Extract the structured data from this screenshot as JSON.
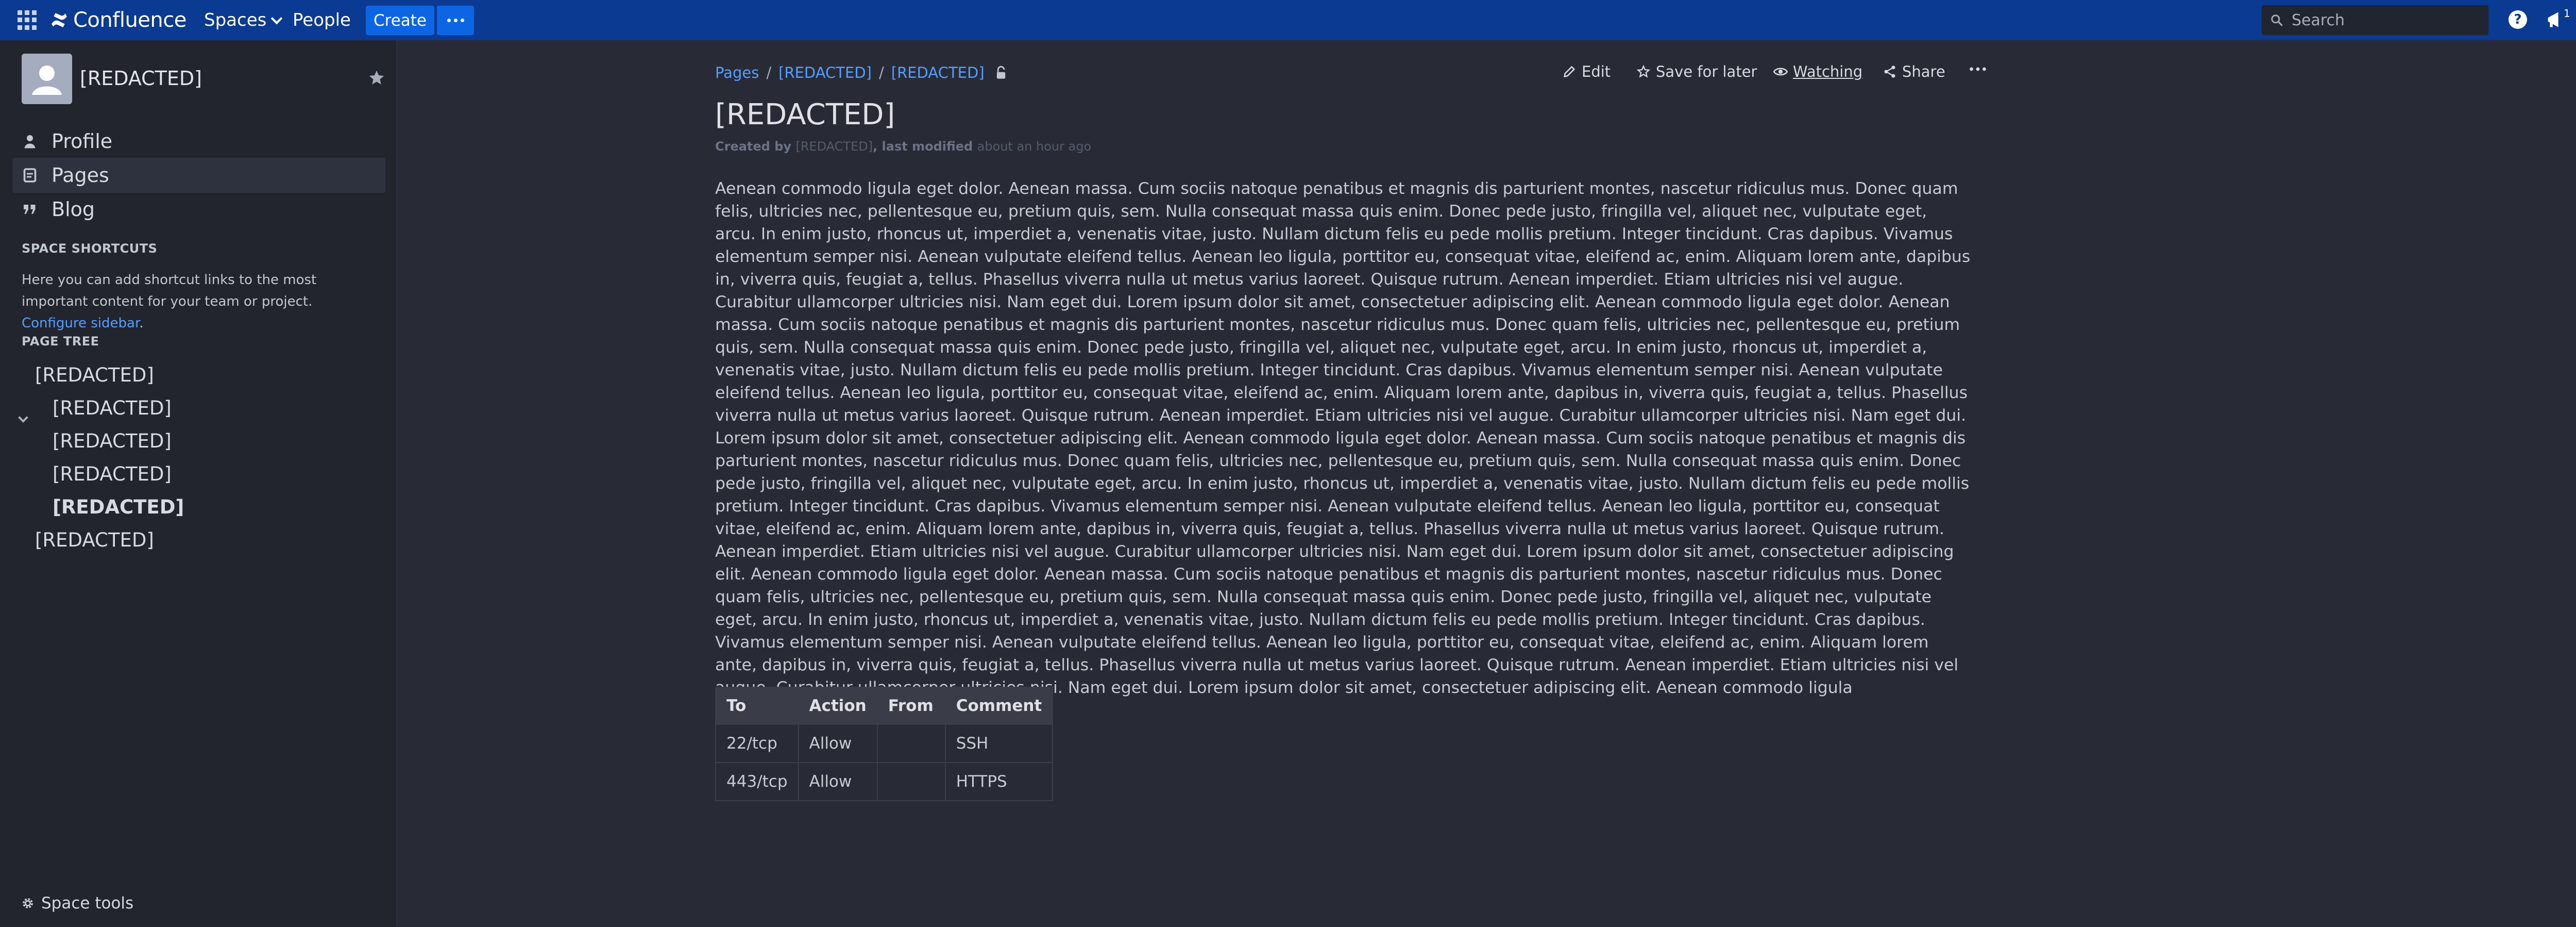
{
  "topnav": {
    "logo_text": "Confluence",
    "spaces_label": "Spaces",
    "people_label": "People",
    "create_label": "Create",
    "search_placeholder": "Search",
    "help_label": "?",
    "notification_count": "1"
  },
  "sidebar": {
    "space_name": "[REDACTED]",
    "items": [
      {
        "label": "Profile",
        "icon": "person-icon"
      },
      {
        "label": "Pages",
        "icon": "document-icon"
      },
      {
        "label": "Blog",
        "icon": "quote-icon"
      }
    ],
    "shortcuts_heading": "SPACE SHORTCUTS",
    "shortcuts_text": "Here you can add shortcut links to the most important content for your team or project.",
    "shortcuts_link": "Configure sidebar",
    "shortcuts_after": ".",
    "page_tree_heading": "PAGE TREE",
    "tree": [
      {
        "label": "[REDACTED]",
        "level": 0
      },
      {
        "label": "[REDACTED]",
        "level": 1
      },
      {
        "label": "[REDACTED]",
        "level": 1
      },
      {
        "label": "[REDACTED]",
        "level": 1
      },
      {
        "label": "[REDACTED]",
        "level": 1,
        "current": true
      },
      {
        "label": "[REDACTED]",
        "level": 0
      }
    ],
    "space_tools_label": "Space tools"
  },
  "breadcrumb": [
    "Pages",
    "[REDACTED]",
    "[REDACTED]"
  ],
  "breadcrumb_sep": "/",
  "actions": {
    "edit": "Edit",
    "save_for_later": "Save for later",
    "watching": "Watching",
    "share": "Share"
  },
  "page": {
    "title": "[REDACTED]",
    "byline_created": "Created by",
    "byline_author": "[REDACTED]",
    "byline_modified": ", last modified",
    "byline_time": "about an hour ago",
    "body": "Aenean commodo ligula eget dolor. Aenean massa. Cum sociis natoque penatibus et magnis dis parturient montes, nascetur ridiculus mus. Donec quam felis, ultricies nec, pellentesque eu, pretium quis, sem. Nulla consequat massa quis enim. Donec pede justo, fringilla vel, aliquet nec, vulputate eget, arcu. In enim justo, rhoncus ut, imperdiet a, venenatis vitae, justo. Nullam dictum felis eu pede mollis pretium. Integer tincidunt. Cras dapibus. Vivamus elementum semper nisi. Aenean vulputate eleifend tellus. Aenean leo ligula, porttitor eu, consequat vitae, eleifend ac, enim. Aliquam lorem ante, dapibus in, viverra quis, feugiat a, tellus. Phasellus viverra nulla ut metus varius laoreet. Quisque rutrum. Aenean imperdiet. Etiam ultricies nisi vel augue. Curabitur ullamcorper ultricies nisi. Nam eget dui. Lorem ipsum dolor sit amet, consectetuer adipiscing elit. Aenean commodo ligula eget dolor. Aenean massa. Cum sociis natoque penatibus et magnis dis parturient montes, nascetur ridiculus mus. Donec quam felis, ultricies nec, pellentesque eu, pretium quis, sem. Nulla consequat massa quis enim. Donec pede justo, fringilla vel, aliquet nec, vulputate eget, arcu. In enim justo, rhoncus ut, imperdiet a, venenatis vitae, justo. Nullam dictum felis eu pede mollis pretium. Integer tincidunt. Cras dapibus. Vivamus elementum semper nisi. Aenean vulputate eleifend tellus. Aenean leo ligula, porttitor eu, consequat vitae, eleifend ac, enim. Aliquam lorem ante, dapibus in, viverra quis, feugiat a, tellus. Phasellus viverra nulla ut metus varius laoreet. Quisque rutrum. Aenean imperdiet. Etiam ultricies nisi vel augue. Curabitur ullamcorper ultricies nisi. Nam eget dui. Lorem ipsum dolor sit amet, consectetuer adipiscing elit. Aenean commodo ligula eget dolor. Aenean massa. Cum sociis natoque penatibus et magnis dis parturient montes, nascetur ridiculus mus. Donec quam felis, ultricies nec, pellentesque eu, pretium quis, sem. Nulla consequat massa quis enim. Donec pede justo, fringilla vel, aliquet nec, vulputate eget, arcu. In enim justo, rhoncus ut, imperdiet a, venenatis vitae, justo. Nullam dictum felis eu pede mollis pretium. Integer tincidunt. Cras dapibus. Vivamus elementum semper nisi. Aenean vulputate eleifend tellus. Aenean leo ligula, porttitor eu, consequat vitae, eleifend ac, enim. Aliquam lorem ante, dapibus in, viverra quis, feugiat a, tellus. Phasellus viverra nulla ut metus varius laoreet. Quisque rutrum. Aenean imperdiet. Etiam ultricies nisi vel augue. Curabitur ullamcorper ultricies nisi. Nam eget dui. Lorem ipsum dolor sit amet, consectetuer adipiscing elit. Aenean commodo ligula eget dolor. Aenean massa. Cum sociis natoque penatibus et magnis dis parturient montes, nascetur ridiculus mus. Donec quam felis, ultricies nec, pellentesque eu, pretium quis, sem. Nulla consequat massa quis enim. Donec pede justo, fringilla vel, aliquet nec, vulputate eget, arcu. In enim justo, rhoncus ut, imperdiet a, venenatis vitae, justo. Nullam dictum felis eu pede mollis pretium. Integer tincidunt. Cras dapibus. Vivamus elementum semper nisi. Aenean vulputate eleifend tellus. Aenean leo ligula, porttitor eu, consequat vitae, eleifend ac, enim. Aliquam lorem ante, dapibus in, viverra quis, feugiat a, tellus. Phasellus viverra nulla ut metus varius laoreet. Quisque rutrum. Aenean imperdiet. Etiam ultricies nisi vel augue. Curabitur ullamcorper ultricies nisi. Nam eget dui. Lorem ipsum dolor sit amet, consectetuer adipiscing elit. Aenean commodo ligula"
  },
  "firewall_table": {
    "headers": [
      "To",
      "Action",
      "From",
      "Comment"
    ],
    "rows": [
      [
        "22/tcp",
        "Allow",
        "",
        "SSH"
      ],
      [
        "443/tcp",
        "Allow",
        "",
        "HTTPS"
      ]
    ]
  },
  "colors": {
    "topnav_bg": "#0a3a91",
    "create_button": "#0c66e4",
    "link": "#579dff",
    "page_bg": "#282b36",
    "sidebar_bg": "#22252e"
  }
}
